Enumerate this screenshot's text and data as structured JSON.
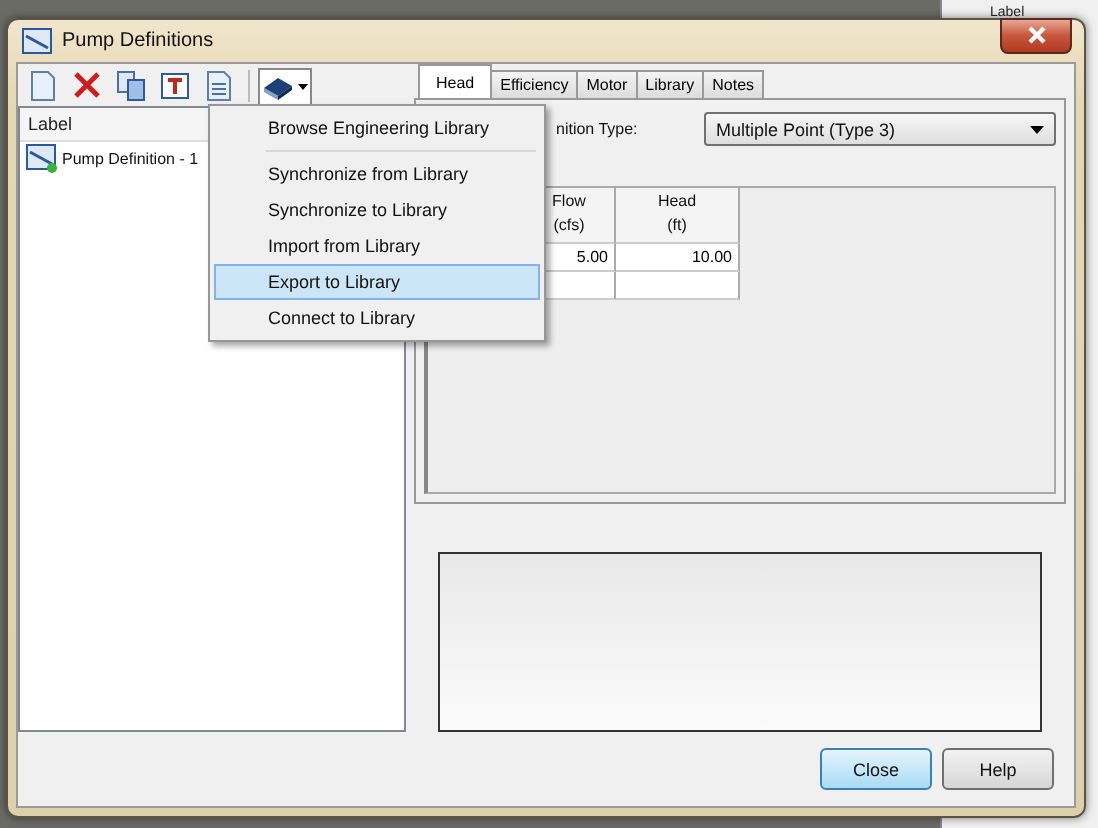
{
  "background_window": {
    "column_label": "Label"
  },
  "window": {
    "title": "Pump Definitions"
  },
  "toolbar": {
    "buttons": [
      {
        "kind": "new"
      },
      {
        "kind": "delete"
      },
      {
        "kind": "copy"
      },
      {
        "kind": "rename"
      },
      {
        "kind": "report"
      },
      {
        "kind": "library",
        "pressed": true
      }
    ]
  },
  "list": {
    "column": "Label",
    "items": [
      {
        "label": "Pump Definition - 1",
        "selected": false
      }
    ]
  },
  "library_menu": {
    "items": [
      {
        "label": "Browse Engineering Library",
        "selected": false,
        "separator_after": true
      },
      {
        "label": "Synchronize from Library",
        "selected": false,
        "separator_after": false
      },
      {
        "label": "Synchronize to Library",
        "selected": false,
        "separator_after": false
      },
      {
        "label": "Import from Library",
        "selected": false,
        "separator_after": false
      },
      {
        "label": "Export to Library",
        "selected": true,
        "separator_after": false
      },
      {
        "label": "Connect to Library",
        "selected": false,
        "separator_after": false
      }
    ]
  },
  "tabs": [
    {
      "label": "Head",
      "selected": true
    },
    {
      "label": "Efficiency",
      "selected": false
    },
    {
      "label": "Motor",
      "selected": false
    },
    {
      "label": "Library",
      "selected": false
    },
    {
      "label": "Notes",
      "selected": false
    }
  ],
  "head_tab": {
    "type_label": "nition Type:",
    "type_value": "Multiple Point (Type 3)",
    "table": {
      "columns": [
        {
          "label": "Flow",
          "unit": "(cfs)"
        },
        {
          "label": "Head",
          "unit": "(ft)"
        }
      ],
      "rows": [
        {
          "cells": [
            "5.00",
            "10.00"
          ]
        }
      ]
    }
  },
  "buttons": [
    {
      "label": "Close",
      "default": true
    },
    {
      "label": "Help",
      "default": false
    }
  ]
}
